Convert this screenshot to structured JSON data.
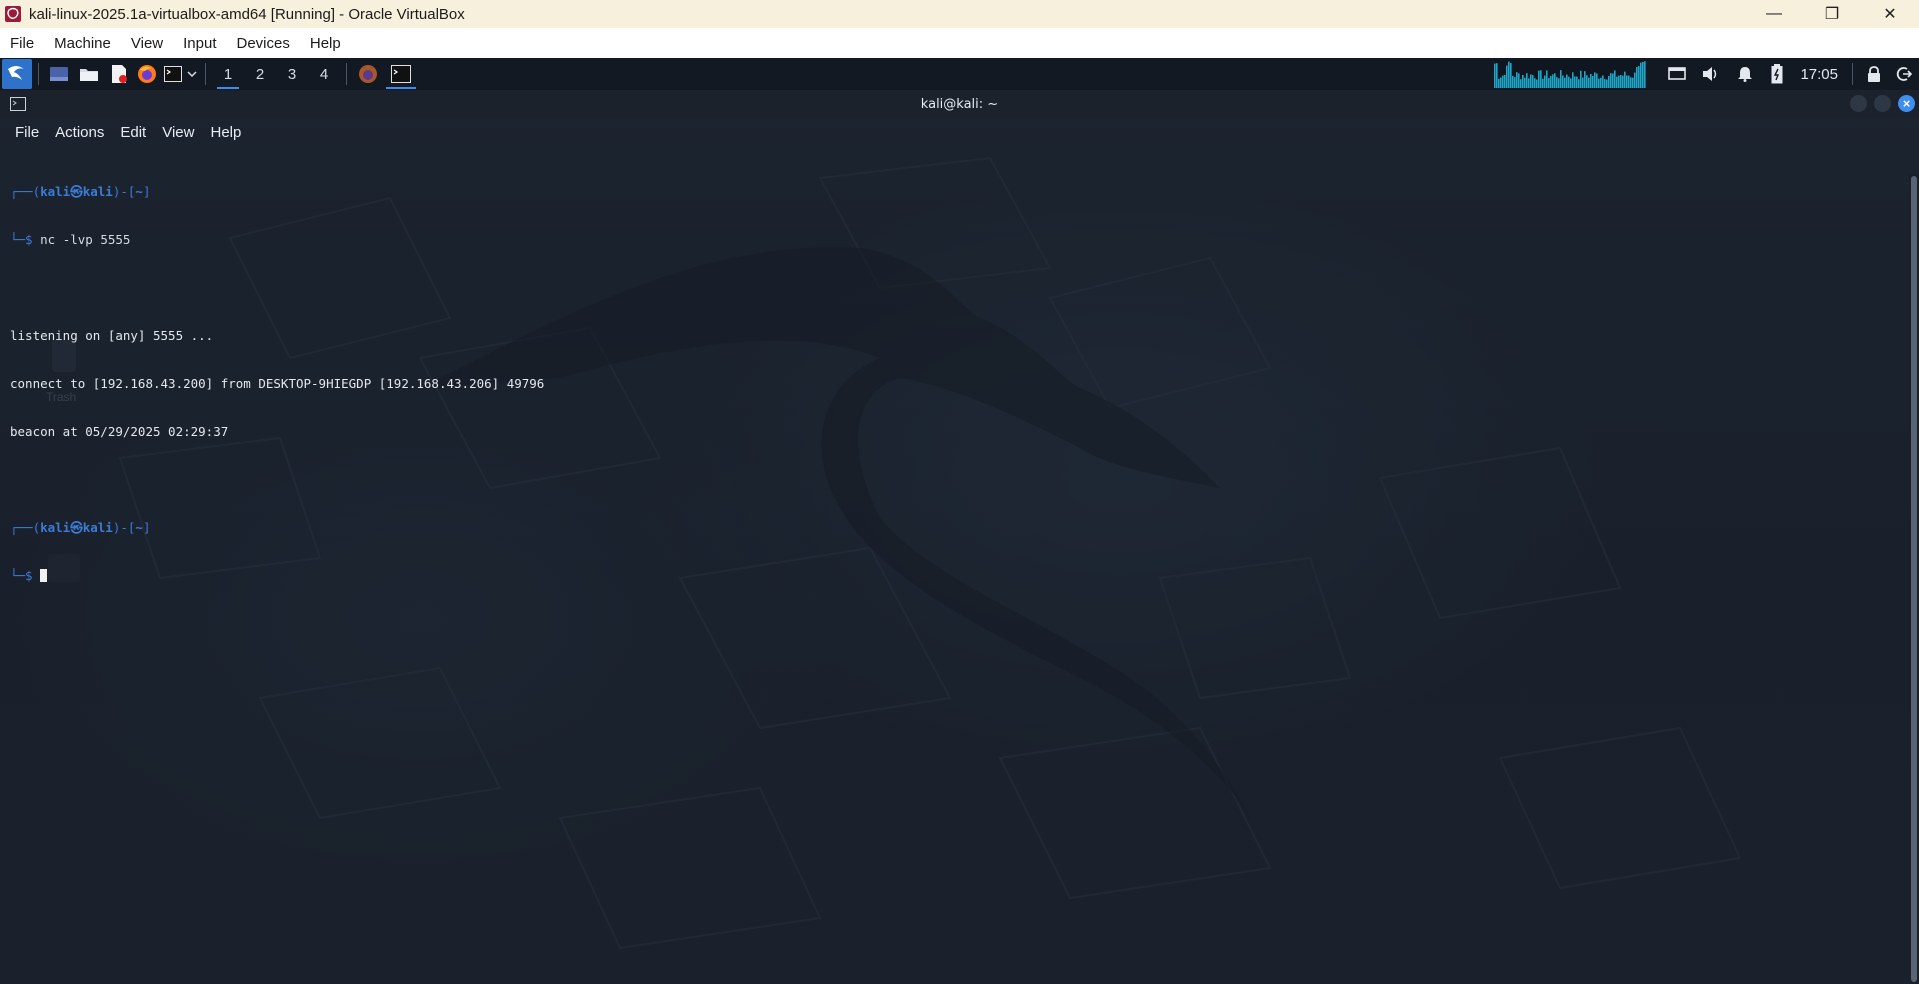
{
  "host": {
    "title": "kali-linux-2025.1a-virtualbox-amd64 [Running] - Oracle VirtualBox",
    "menu": [
      "File",
      "Machine",
      "View",
      "Input",
      "Devices",
      "Help"
    ],
    "window_controls": {
      "minimize": "—",
      "restore": "❐",
      "close": "✕"
    }
  },
  "panel": {
    "workspaces": [
      "1",
      "2",
      "3",
      "4"
    ],
    "active_workspace": "1",
    "clock": "17:05",
    "icons": [
      "kali-menu-icon",
      "show-desktop-icon",
      "file-manager-icon",
      "text-editor-icon",
      "firefox-icon",
      "terminal-icon",
      "firefox-task-icon",
      "terminal-task-icon",
      "display-icon",
      "volume-icon",
      "notifications-icon",
      "battery-icon",
      "lock-icon",
      "logout-icon"
    ],
    "accent": "#3b8cf0"
  },
  "terminal": {
    "title": "kali@kali: ~",
    "menu": [
      "File",
      "Actions",
      "Edit",
      "View",
      "Help"
    ],
    "prompt": {
      "top_left": "┌──(",
      "user": "kali㉿kali",
      "top_mid": ")-[",
      "dir": "~",
      "top_right": "]",
      "bottom": "└─$ "
    },
    "command": {
      "name": "nc",
      "args": " -lvp 5555"
    },
    "output": [
      "listening on [any] 5555 ...",
      "connect to [192.168.43.200] from DESKTOP-9HIEGDP [192.168.43.206] 49796",
      "beacon at 05/29/2025 02:29:37"
    ],
    "colors": {
      "prompt": "#3c7bd8",
      "text": "#e4e8ee",
      "background": "#1e2633"
    }
  },
  "desktop": {
    "trash_label": "Trash"
  }
}
